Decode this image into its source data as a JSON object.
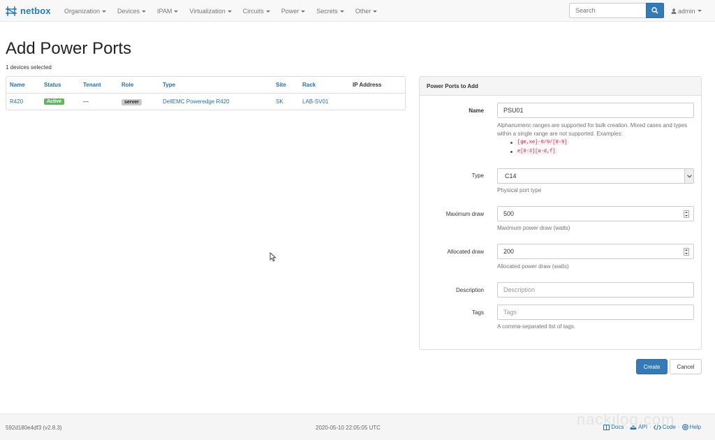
{
  "navbar": {
    "brand": "netbox",
    "items": [
      {
        "label": "Organization"
      },
      {
        "label": "Devices"
      },
      {
        "label": "IPAM"
      },
      {
        "label": "Virtualization"
      },
      {
        "label": "Circuits"
      },
      {
        "label": "Power"
      },
      {
        "label": "Secrets"
      },
      {
        "label": "Other"
      }
    ],
    "search_placeholder": "Search",
    "user": "admin"
  },
  "page": {
    "title": "Add Power Ports",
    "selected_count": "1 devices selected"
  },
  "device_table": {
    "columns": [
      "Name",
      "Status",
      "Tenant",
      "Role",
      "Type",
      "Site",
      "Rack",
      "IP Address"
    ],
    "rows": [
      {
        "name": "R420",
        "status": "Active",
        "tenant": "—",
        "role": "server",
        "type": "DellEMC Poweredge R420",
        "site": "SK",
        "rack": "LAB-SV01",
        "ip_address": ""
      }
    ]
  },
  "form": {
    "heading": "Power Ports to Add",
    "name": {
      "label": "Name",
      "value": "PSU01",
      "help": "Alphanumeric ranges are supported for bulk creation. Mixed cases and types within a single range are not supported. Examples:",
      "examples": [
        "[ge,xe]-0/0/[0-9]",
        "e[0-3][a-d,f]"
      ]
    },
    "type": {
      "label": "Type",
      "value": "C14",
      "help": "Physical port type"
    },
    "maximum_draw": {
      "label": "Maximum draw",
      "value": "500",
      "help": "Maximum power draw (watts)"
    },
    "allocated_draw": {
      "label": "Allocated draw",
      "value": "200",
      "help": "Allocated power draw (watts)"
    },
    "description": {
      "label": "Description",
      "placeholder": "Description"
    },
    "tags": {
      "label": "Tags",
      "placeholder": "Tags",
      "help": "A comma-separated list of tags."
    }
  },
  "buttons": {
    "create": "Create",
    "cancel": "Cancel"
  },
  "footer": {
    "version": "592d180e4df3 (v2.8.3)",
    "timestamp": "2020-05-10 22:05:05 UTC",
    "links": {
      "docs": "Docs",
      "api": "API",
      "code": "Code",
      "help": "Help"
    },
    "watermark": "nackilog.com"
  },
  "colors": {
    "primary": "#337ab7",
    "link": "#2a6fa8",
    "active_badge": "#5cb85c",
    "role_badge": "#c9c9c9"
  }
}
